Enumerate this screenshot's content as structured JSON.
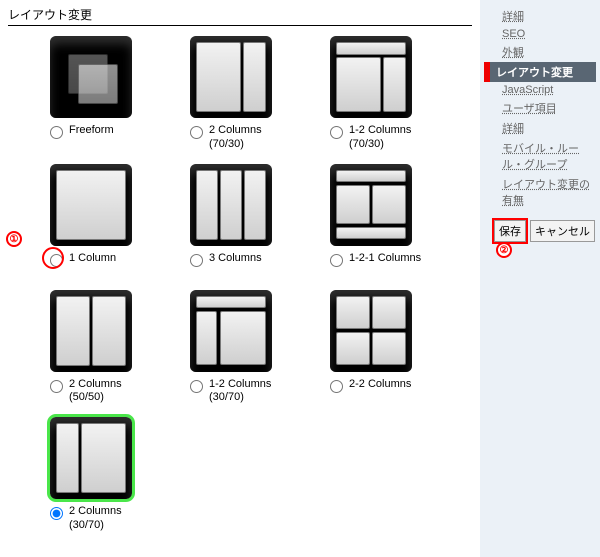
{
  "page": {
    "title": "レイアウト変更"
  },
  "options": [
    {
      "label": "Freeform",
      "selected": false,
      "layout": "freeform"
    },
    {
      "label": "2 Columns\n(70/30)",
      "selected": false,
      "layout": "c70_30"
    },
    {
      "label": "1-2 Columns\n(70/30)",
      "selected": false,
      "layout": "c1_2_7030"
    },
    {
      "label": "1 Column",
      "selected": false,
      "layout": "c1",
      "mark_radio_red": true
    },
    {
      "label": "3 Columns",
      "selected": false,
      "layout": "c3"
    },
    {
      "label": "1-2-1 Columns",
      "selected": false,
      "layout": "c1_2_1"
    },
    {
      "label": "2 Columns\n(50/50)",
      "selected": false,
      "layout": "c50_50"
    },
    {
      "label": "1-2 Columns\n(30/70)",
      "selected": false,
      "layout": "c1_2_3070"
    },
    {
      "label": "2-2 Columns",
      "selected": false,
      "layout": "c2_2"
    },
    {
      "label": "2 Columns\n(30/70)",
      "selected": true,
      "layout": "c30_70",
      "highlight": true
    }
  ],
  "annotations": {
    "one": "①",
    "two": "②"
  },
  "sidebar": {
    "items": [
      {
        "label": "詳細"
      },
      {
        "label": "SEO"
      },
      {
        "label": "外観"
      },
      {
        "label": "レイアウト変更",
        "active": true
      },
      {
        "label": "JavaScript"
      },
      {
        "label": "ユーザ項目"
      },
      {
        "label": "詳細"
      },
      {
        "label": "モバイル・ルール・グループ"
      },
      {
        "label": "レイアウト変更の有無"
      }
    ],
    "save": "保存",
    "cancel": "キャンセル"
  }
}
